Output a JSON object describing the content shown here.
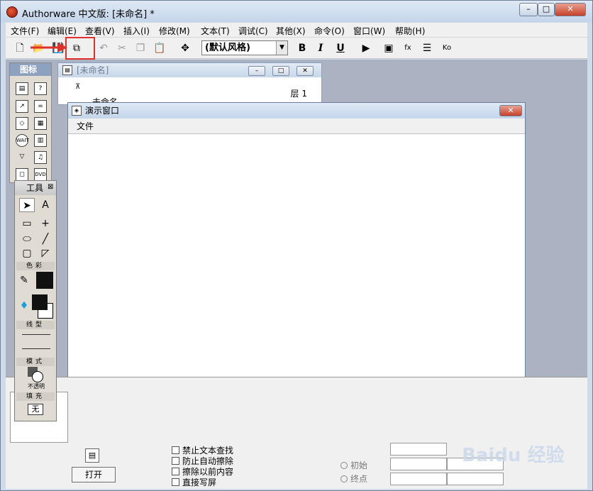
{
  "app": {
    "title": "Authorware 中文版: [未命名] *"
  },
  "window_controls": {
    "minimize": "–",
    "maximize": "□",
    "close": "✕"
  },
  "menu": [
    "文件(F)",
    "编辑(E)",
    "查看(V)",
    "插入(I)",
    "修改(M)",
    "文本(T)",
    "调试(C)",
    "其他(X)",
    "命令(O)",
    "窗口(W)",
    "帮助(H)"
  ],
  "toolbar": {
    "style_value": "(默认风格)",
    "bold": "B",
    "italic": "I",
    "underline": "U",
    "tooltip": "导入"
  },
  "icon_palette": {
    "title": "图标",
    "wait_label": "WAIT",
    "dvd_label": "DVD"
  },
  "flow_window": {
    "title": "[未命名]",
    "level_label": "层 1",
    "file_label": "未命名"
  },
  "tools_palette": {
    "title": "工具",
    "color_section": "色彩",
    "line_section": "线型",
    "mode_section": "模式",
    "mode_value": "不透明",
    "fill_section": "填充",
    "fill_value": "无"
  },
  "presentation": {
    "title": "演示窗口",
    "menu_file": "文件"
  },
  "properties": {
    "open_button": "打开",
    "options": [
      "禁止文本查找",
      "防止自动擦除",
      "擦除以前内容",
      "直接写屏"
    ],
    "radios": [
      "初始",
      "终点"
    ]
  },
  "watermark": "Baidu 经验"
}
